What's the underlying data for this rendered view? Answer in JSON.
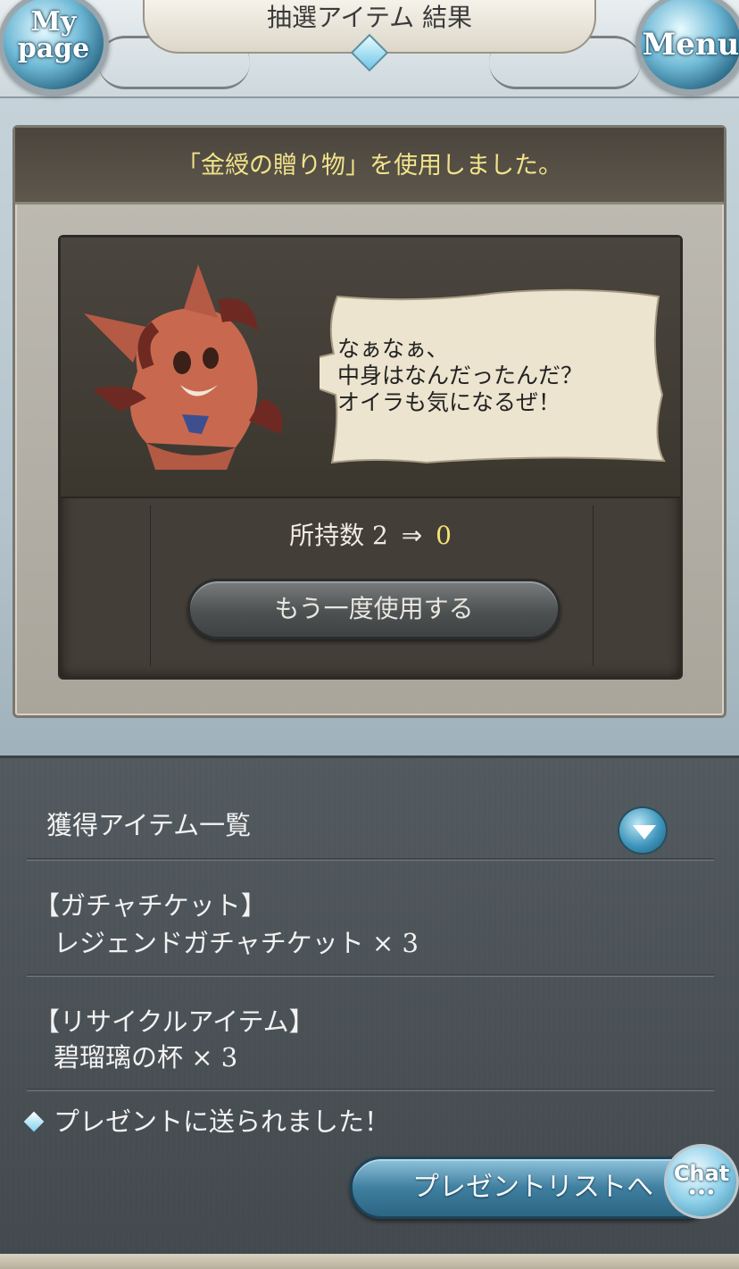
{
  "header": {
    "title": "抽選アイテム 結果",
    "mypage_line1": "My",
    "mypage_line2": "page",
    "menu_label": "Menu"
  },
  "result_panel": {
    "banner_text": "「金綬の贈り物」を使用しました。",
    "speech": {
      "line1": "なぁなぁ、",
      "line2": "中身はなんだったんだ？",
      "line3": "オイラも気になるぜ！"
    },
    "count": {
      "label": "所持数",
      "before": "2",
      "arrow": "⇒",
      "after": "0"
    },
    "use_again_button": "もう一度使用する"
  },
  "acquired": {
    "title": "獲得アイテム一覧",
    "groups": [
      {
        "category": "【ガチャチケット】",
        "name": "レジェンドガチャチケット",
        "qty": "× 3"
      },
      {
        "category": "【リサイクルアイテム】",
        "name": "碧瑠璃の杯",
        "qty": "× 3"
      }
    ],
    "sent_message": "プレゼントに送られました！",
    "present_button": "プレゼントリストへ",
    "chat_label": "Chat",
    "chat_dots": "•••"
  },
  "colors": {
    "banner_text": "#f1e38a",
    "count_after": "#f4e37a",
    "accent_blue": "#3f7f9f"
  }
}
